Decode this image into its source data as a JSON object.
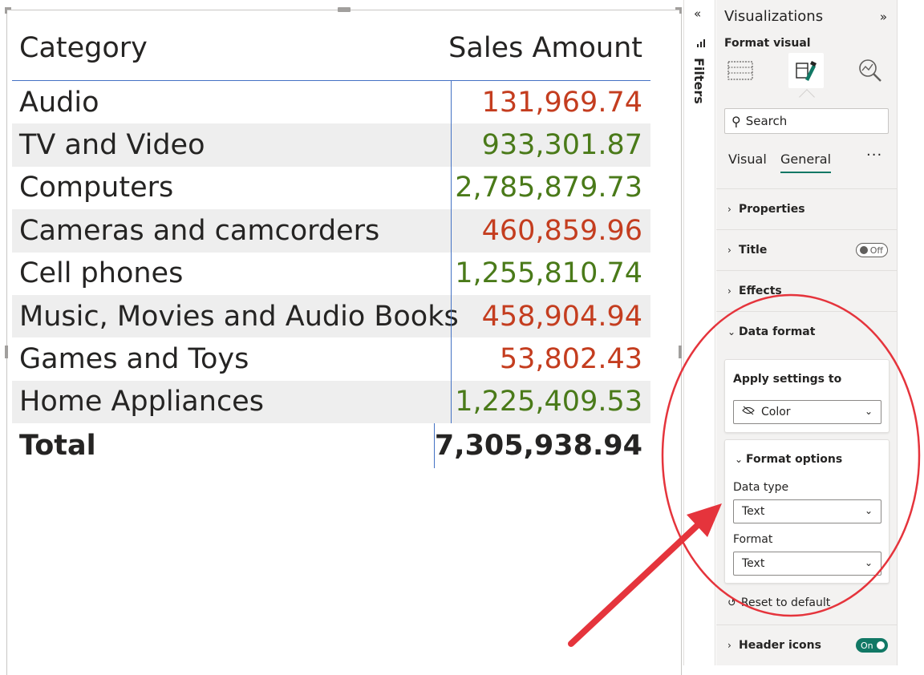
{
  "table": {
    "header": {
      "category": "Category",
      "sales": "Sales Amount"
    },
    "rows": [
      {
        "category": "Audio",
        "sales": "131,969.74",
        "tone": "neg"
      },
      {
        "category": "TV and Video",
        "sales": "933,301.87",
        "tone": "pos"
      },
      {
        "category": "Computers",
        "sales": "2,785,879.73",
        "tone": "pos"
      },
      {
        "category": "Cameras and camcorders",
        "sales": "460,859.96",
        "tone": "neg"
      },
      {
        "category": "Cell phones",
        "sales": "1,255,810.74",
        "tone": "pos"
      },
      {
        "category": "Music, Movies and Audio Books",
        "sales": "458,904.94",
        "tone": "neg"
      },
      {
        "category": "Games and Toys",
        "sales": "53,802.43",
        "tone": "neg"
      },
      {
        "category": "Home Appliances",
        "sales": "1,225,409.53",
        "tone": "pos"
      }
    ],
    "total": {
      "label": "Total",
      "value": "7,305,938.94"
    },
    "colors": {
      "negative": "#c43d1f",
      "positive": "#4a7a19",
      "grid_line": "#4472c4"
    }
  },
  "filters": {
    "label": "Filters",
    "collapse_icon": "double-chevron-left-icon"
  },
  "viz_pane": {
    "title": "Visualizations",
    "expand_icon": "double-chevron-right-icon",
    "subtitle": "Format visual",
    "icons": [
      "table-build-icon",
      "format-paintbrush-icon",
      "analytics-magnifier-icon"
    ],
    "search_placeholder": "Search",
    "tabs": {
      "visual": "Visual",
      "general": "General",
      "more": "···"
    },
    "sections": {
      "properties": "Properties",
      "title": "Title",
      "title_toggle": "Off",
      "effects": "Effects",
      "data_format": "Data format",
      "header_icons": "Header icons",
      "header_icons_toggle": "On"
    },
    "data_format": {
      "apply_label": "Apply settings to",
      "apply_value": "Color",
      "format_options": "Format options",
      "data_type_label": "Data type",
      "data_type_value": "Text",
      "format_label": "Format",
      "format_value": "Text",
      "reset": "Reset to default"
    },
    "accent": "#117865"
  },
  "annotation": {
    "color": "#e5343c"
  }
}
